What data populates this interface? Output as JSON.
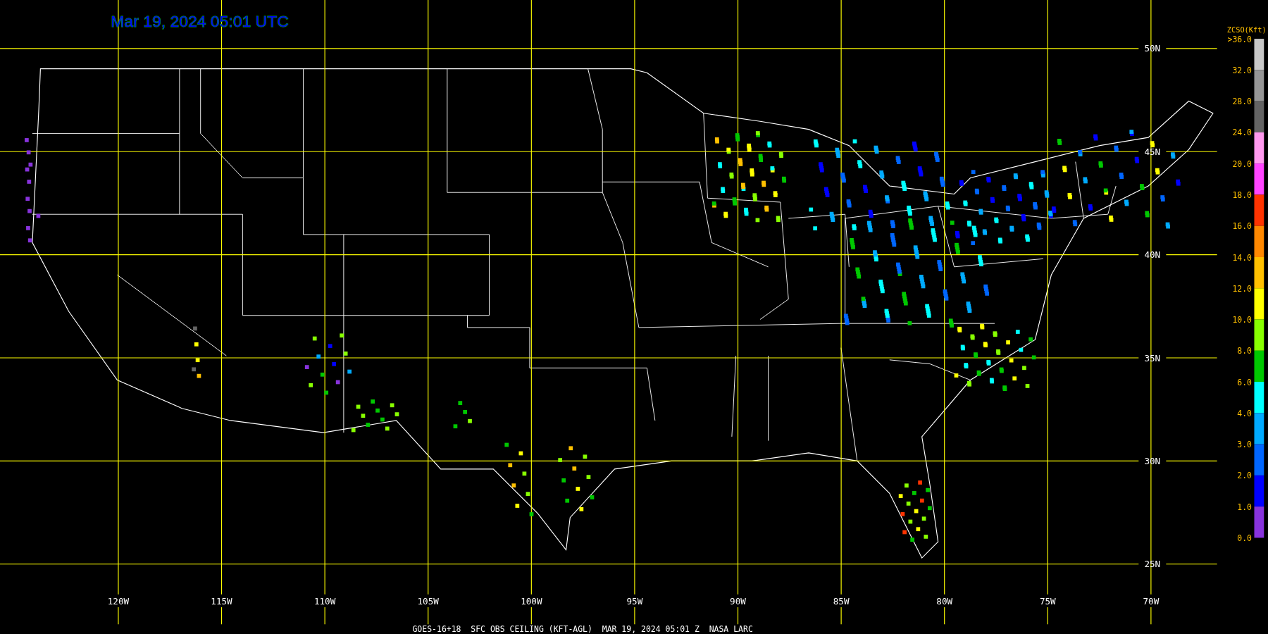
{
  "title": "Mar 19, 2024 05:01 UTC",
  "longitude_labels": [
    "120W",
    "115W",
    "110W",
    "105W",
    "100W",
    "95W",
    "90W",
    "85W",
    "80W",
    "75W",
    "70W"
  ],
  "latitude_labels": [
    "50N",
    "45N",
    "40N",
    "35N",
    "30N",
    "25N"
  ],
  "legend": {
    "heading": "ZCSO(Kft)",
    "labels": [
      ">36.0",
      "32.0",
      "28.0",
      "24.0",
      "20.0",
      "18.0",
      "16.0",
      "14.0",
      "12.0",
      "10.0",
      "8.0",
      "6.0",
      "4.0",
      "3.0",
      "2.0",
      "1.0",
      "0.0"
    ],
    "segments": [
      {
        "color": "#c8c8c8"
      },
      {
        "color": "#969696"
      },
      {
        "color": "#646464"
      },
      {
        "color": "#ff99ee"
      },
      {
        "color": "#ff44ff"
      },
      {
        "color": "#ff3300"
      },
      {
        "color": "#ff8800"
      },
      {
        "color": "#ffc000"
      },
      {
        "color": "#ffff00"
      },
      {
        "color": "#88ff00"
      },
      {
        "color": "#00c800"
      },
      {
        "color": "#00ffff"
      },
      {
        "color": "#00aaff"
      },
      {
        "color": "#0066ff"
      },
      {
        "color": "#0000ff"
      },
      {
        "color": "#8833dd"
      }
    ]
  },
  "caption": "GOES-16+18  SFC OBS CEILING (KFT-AGL)  MAR 19, 2024 05:01 Z  NASA LARC"
}
